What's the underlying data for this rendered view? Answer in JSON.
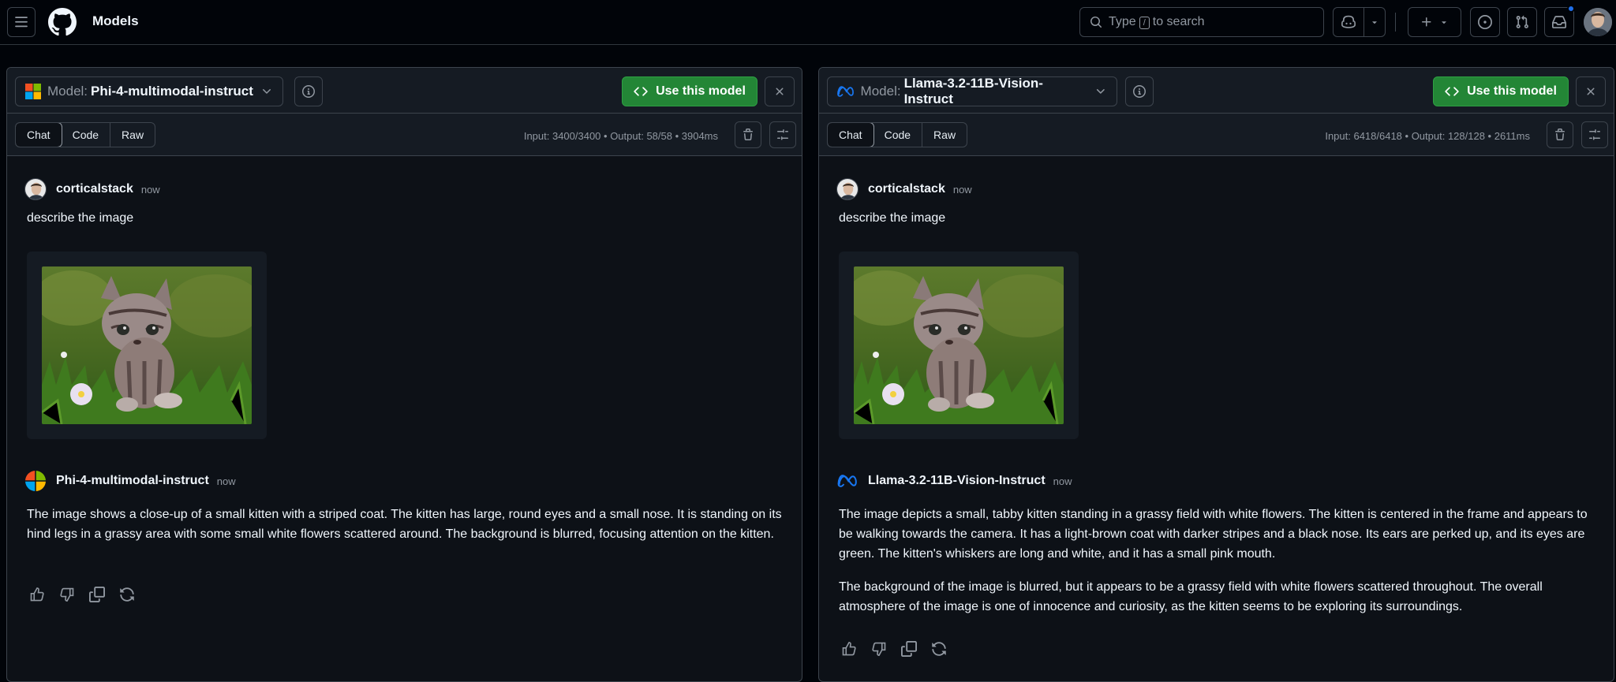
{
  "nav": {
    "title": "Models",
    "search_prefix": "Type",
    "search_key": "/",
    "search_suffix": "to search"
  },
  "panels": [
    {
      "model_prefix": "Model:",
      "model_name": "Phi-4-multimodal-instruct",
      "use_button": "Use this model",
      "tabs": [
        "Chat",
        "Code",
        "Raw"
      ],
      "stats": "Input: 3400/3400 • Output: 58/58 • 3904ms",
      "user_name": "corticalstack",
      "user_time": "now",
      "prompt": "describe the image",
      "assistant_name": "Phi-4-multimodal-instruct",
      "assistant_time": "now",
      "response": [
        "The image shows a close-up of a small kitten with a striped coat. The kitten has large, round eyes and a small nose. It is standing on its hind legs in a grassy area with some small white flowers scattered around. The background is blurred, focusing attention on the kitten."
      ]
    },
    {
      "model_prefix": "Model:",
      "model_name": "Llama-3.2-11B-Vision-Instruct",
      "use_button": "Use this model",
      "tabs": [
        "Chat",
        "Code",
        "Raw"
      ],
      "stats": "Input: 6418/6418 • Output: 128/128 • 2611ms",
      "user_name": "corticalstack",
      "user_time": "now",
      "prompt": "describe the image",
      "assistant_name": "Llama-3.2-11B-Vision-Instruct",
      "assistant_time": "now",
      "response": [
        "The image depicts a small, tabby kitten standing in a grassy field with white flowers. The kitten is centered in the frame and appears to be walking towards the camera. It has a light-brown coat with darker stripes and a black nose. Its ears are perked up, and its eyes are green. The kitten's whiskers are long and white, and it has a small pink mouth.",
        "The background of the image is blurred, but it appears to be a grassy field with white flowers scattered throughout. The overall atmosphere of the image is one of innocence and curiosity, as the kitten seems to be exploring its surroundings."
      ]
    }
  ],
  "colors": {
    "background": "#010409",
    "panel": "#0d1117",
    "accent_green": "#238636",
    "border": "#3d444d",
    "muted_text": "#9198a1"
  }
}
